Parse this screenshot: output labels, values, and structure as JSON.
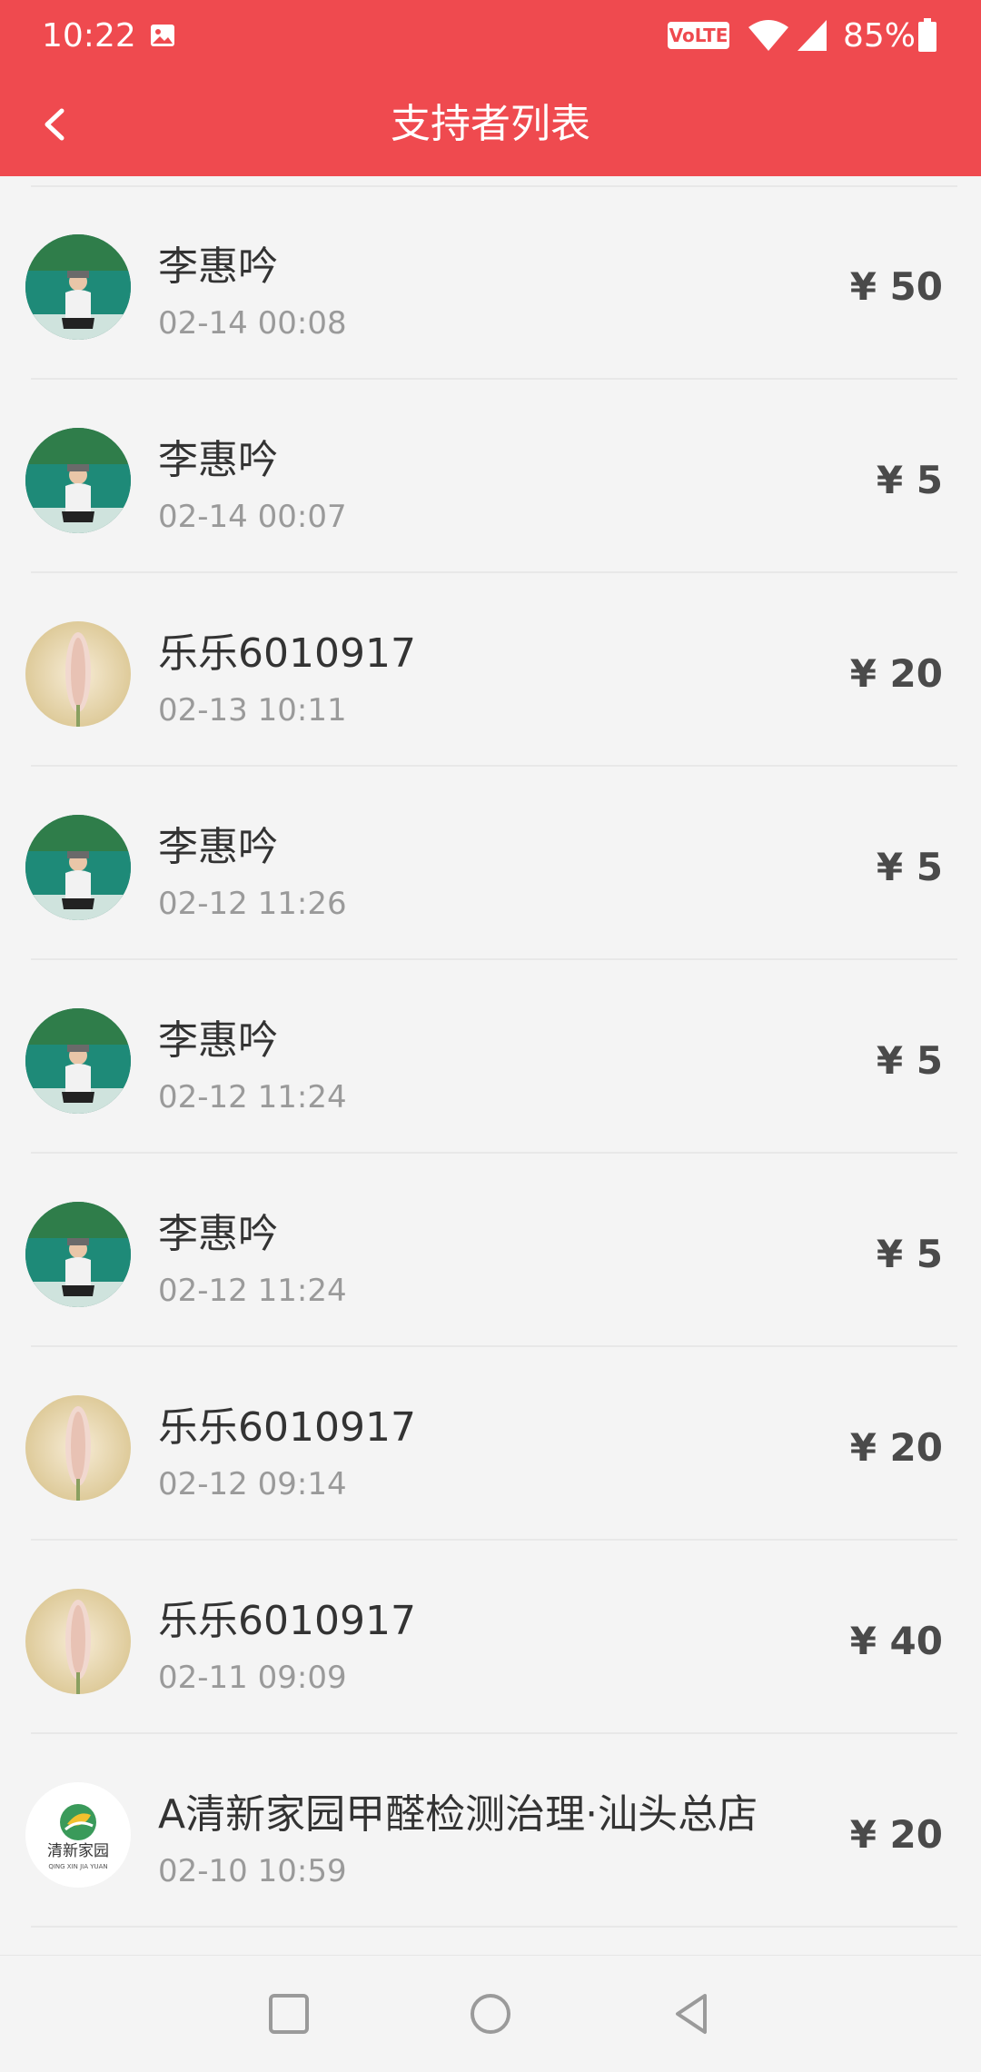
{
  "status_bar": {
    "time": "10:22",
    "volte": "VoLTE",
    "battery_pct": "85%",
    "icons": [
      "image-icon",
      "wifi-icon",
      "signal-icon",
      "battery-icon"
    ]
  },
  "header": {
    "title": "支持者列表",
    "back_icon": "chevron-left-icon",
    "bg_color": "#ef4a4f"
  },
  "supporters": [
    {
      "name": "李惠吟",
      "time": "02-14 00:08",
      "amount": "¥ 50",
      "avatar": "lake-photo"
    },
    {
      "name": "李惠吟",
      "time": "02-14 00:07",
      "amount": "¥ 5",
      "avatar": "lake-photo"
    },
    {
      "name": "乐乐6010917",
      "time": "02-13 10:11",
      "amount": "¥ 20",
      "avatar": "flower-photo"
    },
    {
      "name": "李惠吟",
      "time": "02-12 11:26",
      "amount": "¥ 5",
      "avatar": "lake-photo"
    },
    {
      "name": "李惠吟",
      "time": "02-12 11:24",
      "amount": "¥ 5",
      "avatar": "lake-photo"
    },
    {
      "name": "李惠吟",
      "time": "02-12 11:24",
      "amount": "¥ 5",
      "avatar": "lake-photo"
    },
    {
      "name": "乐乐6010917",
      "time": "02-12 09:14",
      "amount": "¥ 20",
      "avatar": "flower-photo"
    },
    {
      "name": "乐乐6010917",
      "time": "02-11 09:09",
      "amount": "¥ 40",
      "avatar": "flower-photo"
    },
    {
      "name": "A清新家园甲醛检测治理·汕头总店",
      "time": "02-10 10:59",
      "amount": "¥ 20",
      "avatar": "logo",
      "logo_text": "清新家园",
      "logo_subtext": "QING XIN JIA YUAN"
    }
  ],
  "nav_bar": {
    "icons": [
      "recents-square-icon",
      "home-circle-icon",
      "back-triangle-icon"
    ]
  }
}
